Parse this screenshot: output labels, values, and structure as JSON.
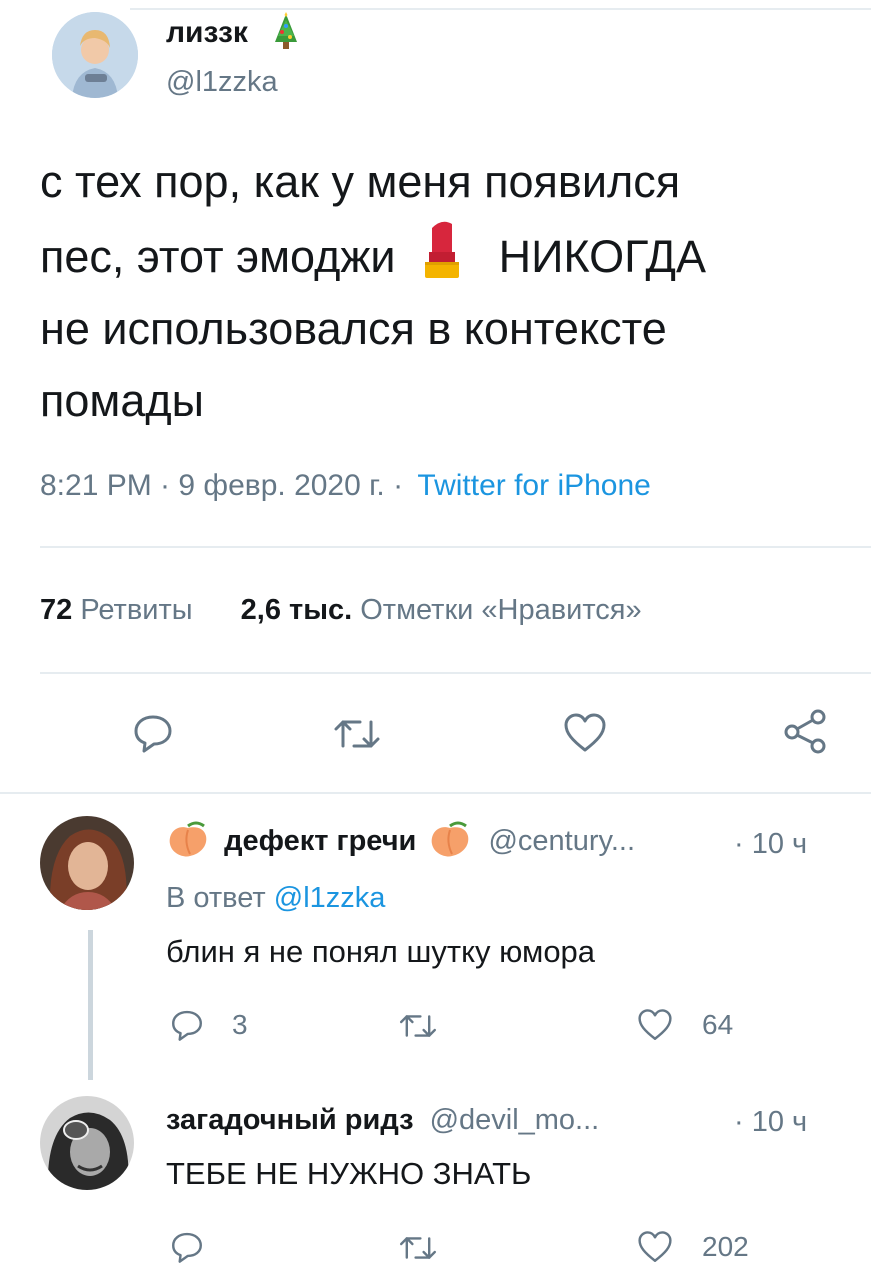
{
  "tweet": {
    "display_name": "лиззк",
    "handle": "@l1zzka",
    "text_lines": [
      "с тех пор, как у меня появился",
      "пес, этот эмоджи",
      "НИКОГДА",
      "не использовался в контексте",
      "помады"
    ],
    "time": "8:21 PM · 9 февр. 2020 г. ·",
    "source": "Twitter for iPhone",
    "retweets_count": "72",
    "retweets_label": "Ретвиты",
    "likes_count": "2,6 тыс.",
    "likes_label": "Отметки «Нравится»"
  },
  "replies": [
    {
      "display_name": "дефект гречи",
      "handle": "@century...",
      "time": "· 10 ч",
      "reply_to_prefix": "В ответ",
      "reply_to_handle": "@l1zzka",
      "text": "блин я не понял шутку юмора",
      "reply_count": "3",
      "like_count": "64"
    },
    {
      "display_name": "загадочный ридз",
      "handle": "@devil_mo...",
      "time": "· 10 ч",
      "text": "ТЕБЕ НЕ НУЖНО ЗНАТЬ",
      "like_count": "202"
    }
  ],
  "icons": {
    "name_emoji": "christmas-tree-icon",
    "inline_emoji": "lipstick-icon",
    "reply_name_emoji": "peach-icon"
  },
  "colors": {
    "link": "#1b95e0",
    "muted": "#657786",
    "divider": "#e6ecf0"
  }
}
